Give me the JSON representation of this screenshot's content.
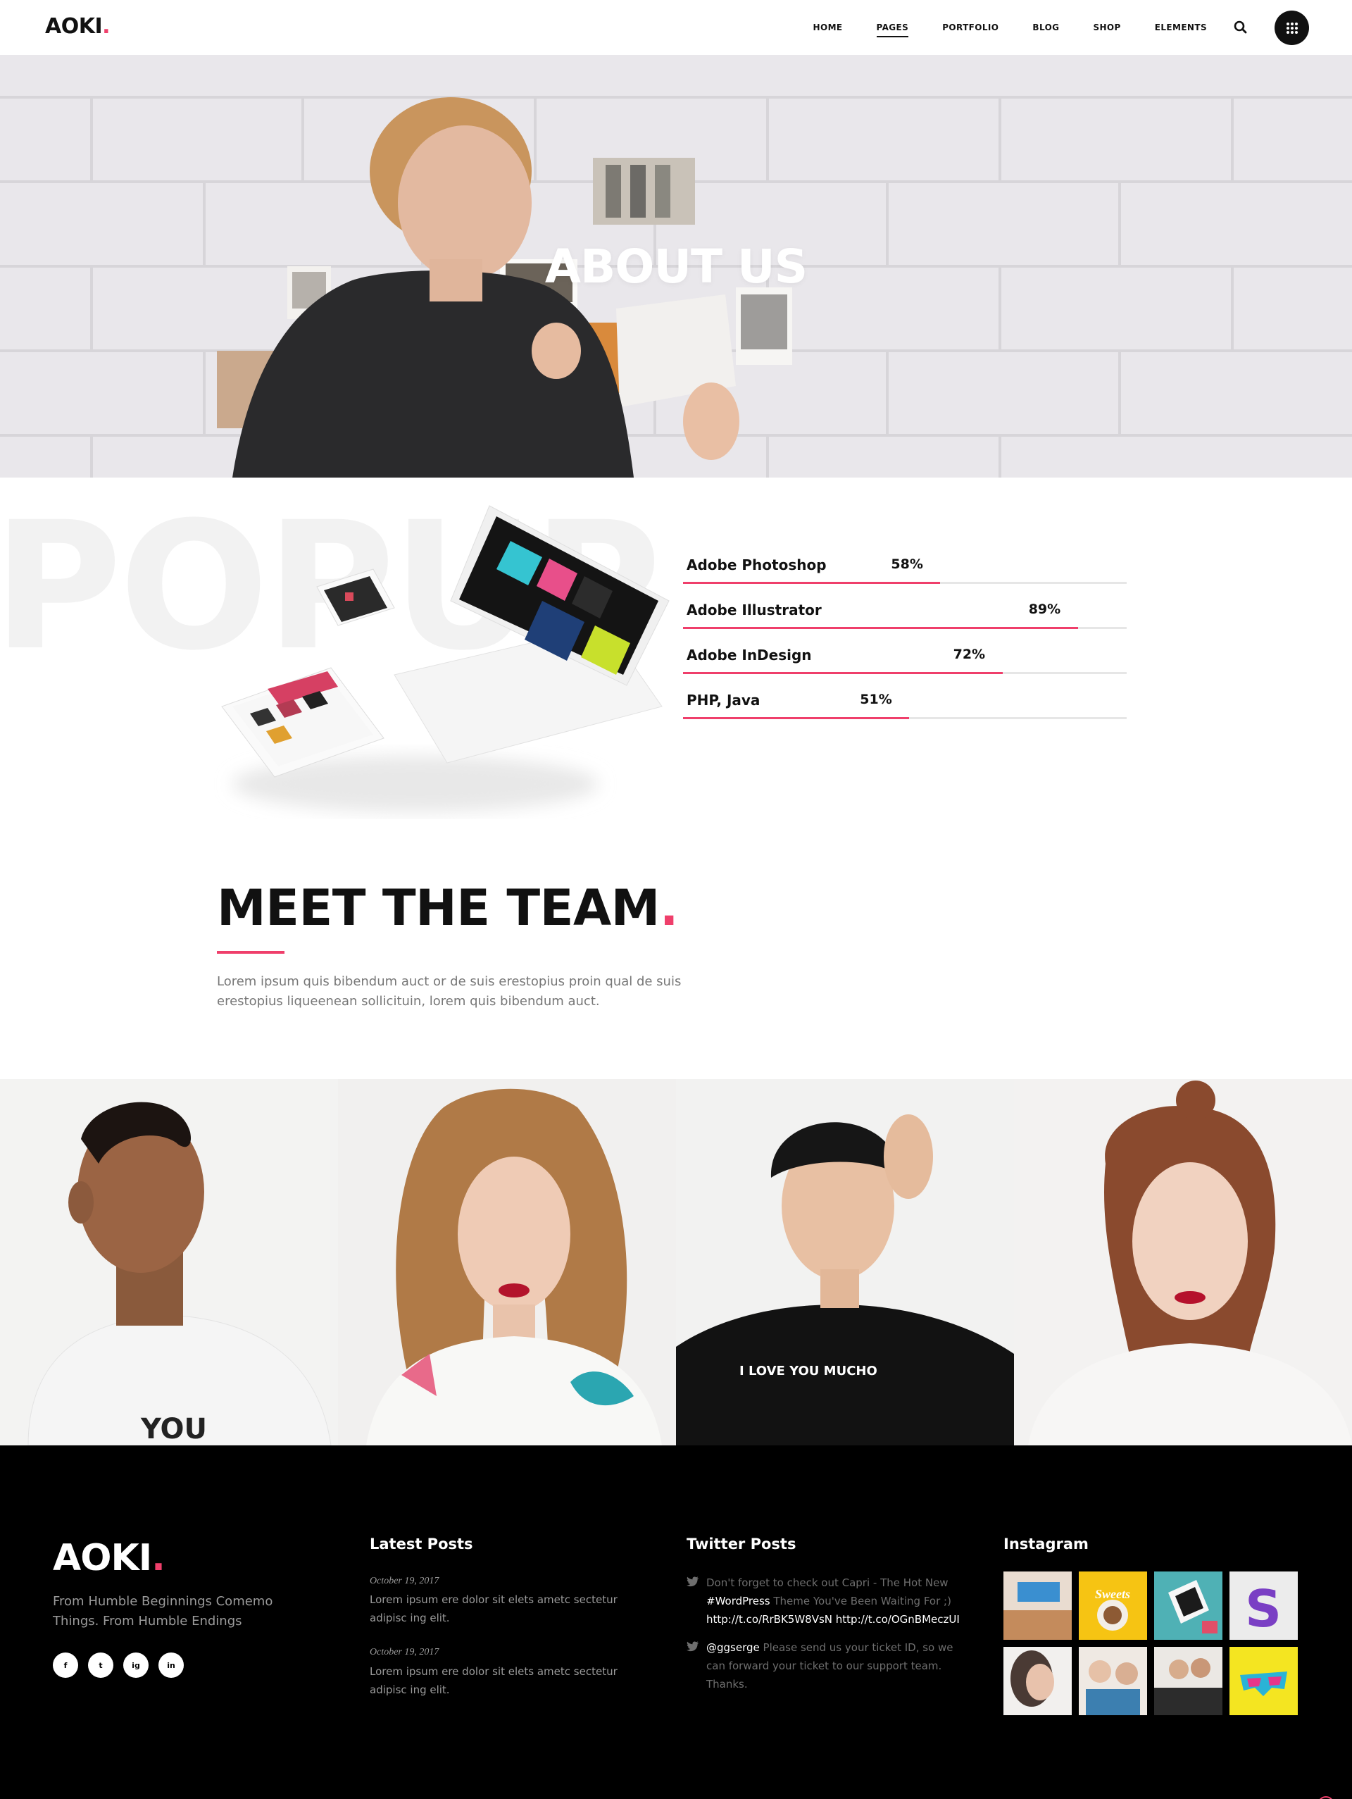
{
  "header": {
    "logo": "AOKI",
    "logo_dot": ".",
    "nav": [
      "HOME",
      "PAGES",
      "PORTFOLIO",
      "BLOG",
      "SHOP",
      "ELEMENTS"
    ],
    "active_nav": "PAGES"
  },
  "hero": {
    "title": "ABOUT US"
  },
  "skills": {
    "background_word": "POPUP",
    "items": [
      {
        "name": "Adobe Photoshop",
        "percent_label": "58%",
        "value": 58
      },
      {
        "name": "Adobe Illustrator",
        "percent_label": "89%",
        "value": 89
      },
      {
        "name": "Adobe InDesign",
        "percent_label": "72%",
        "value": 72
      },
      {
        "name": "PHP, Java",
        "percent_label": "51%",
        "value": 51
      }
    ],
    "bar_color": "#ef3f6b"
  },
  "team": {
    "title": "MEET THE TEAM",
    "title_dot": ".",
    "text": "Lorem ipsum quis bibendum auct or de suis erestopius proin qual de suis erestopius liqueenean sollicituin, lorem quis bibendum auct.",
    "shirt_text_1": "YOU",
    "shirt_text_3": "I LOVE YOU MUCHO"
  },
  "footer": {
    "logo": "AOKI",
    "logo_dot": ".",
    "tagline": "From Humble Beginnings Comemo Things. From Humble Endings",
    "social": [
      "f",
      "t",
      "ig",
      "in"
    ],
    "latest_posts": {
      "heading": "Latest Posts",
      "posts": [
        {
          "date": "October 19, 2017",
          "text": "Lorem ipsum ere dolor sit elets ametc sectetur adipisc ing elit."
        },
        {
          "date": "October 19, 2017",
          "text": "Lorem ipsum ere dolor sit elets ametc sectetur adipisc ing elit."
        }
      ]
    },
    "twitter": {
      "heading": "Twitter Posts",
      "tweets": [
        {
          "text_a": "Don't forget to check out Capri - The Hot New ",
          "link_a": "#WordPress",
          "text_b": " Theme You've Been Waiting For ;) ",
          "link_b": "http://t.co/RrBK5W8VsN http://t.co/OGnBMeczUI"
        },
        {
          "link_a": "@ggserge",
          "text_a": " Please send us your ticket ID, so we can forward your ticket to our support team. Thanks."
        }
      ]
    },
    "instagram": {
      "heading": "Instagram"
    }
  },
  "accent_color": "#ef3f6b"
}
